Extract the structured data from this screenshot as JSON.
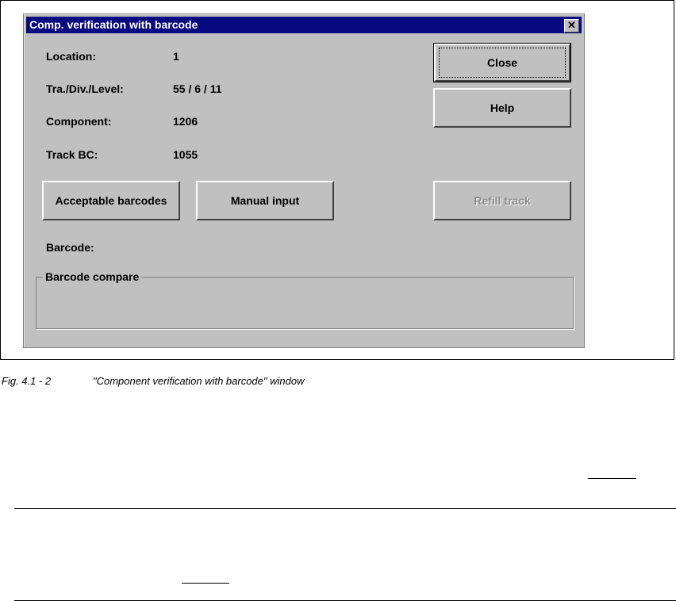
{
  "dialog": {
    "title": "Comp. verification with barcode",
    "close_x": "✕",
    "fields": [
      {
        "label": "Location:",
        "value": "1"
      },
      {
        "label": "Tra./Div./Level:",
        "value": "55 / 6 / 11"
      },
      {
        "label": "Component:",
        "value": "1206"
      },
      {
        "label": "Track BC:",
        "value": "1055"
      }
    ],
    "buttons": {
      "close": "Close",
      "help": "Help",
      "acceptable": "Acceptable barcodes",
      "manual": "Manual input",
      "refill": "Refill track"
    },
    "barcode_label": "Barcode:",
    "group_label": "Barcode compare"
  },
  "caption": {
    "number": "Fig. 4.1 - 2",
    "text": "\"Component verification with barcode\" window"
  }
}
